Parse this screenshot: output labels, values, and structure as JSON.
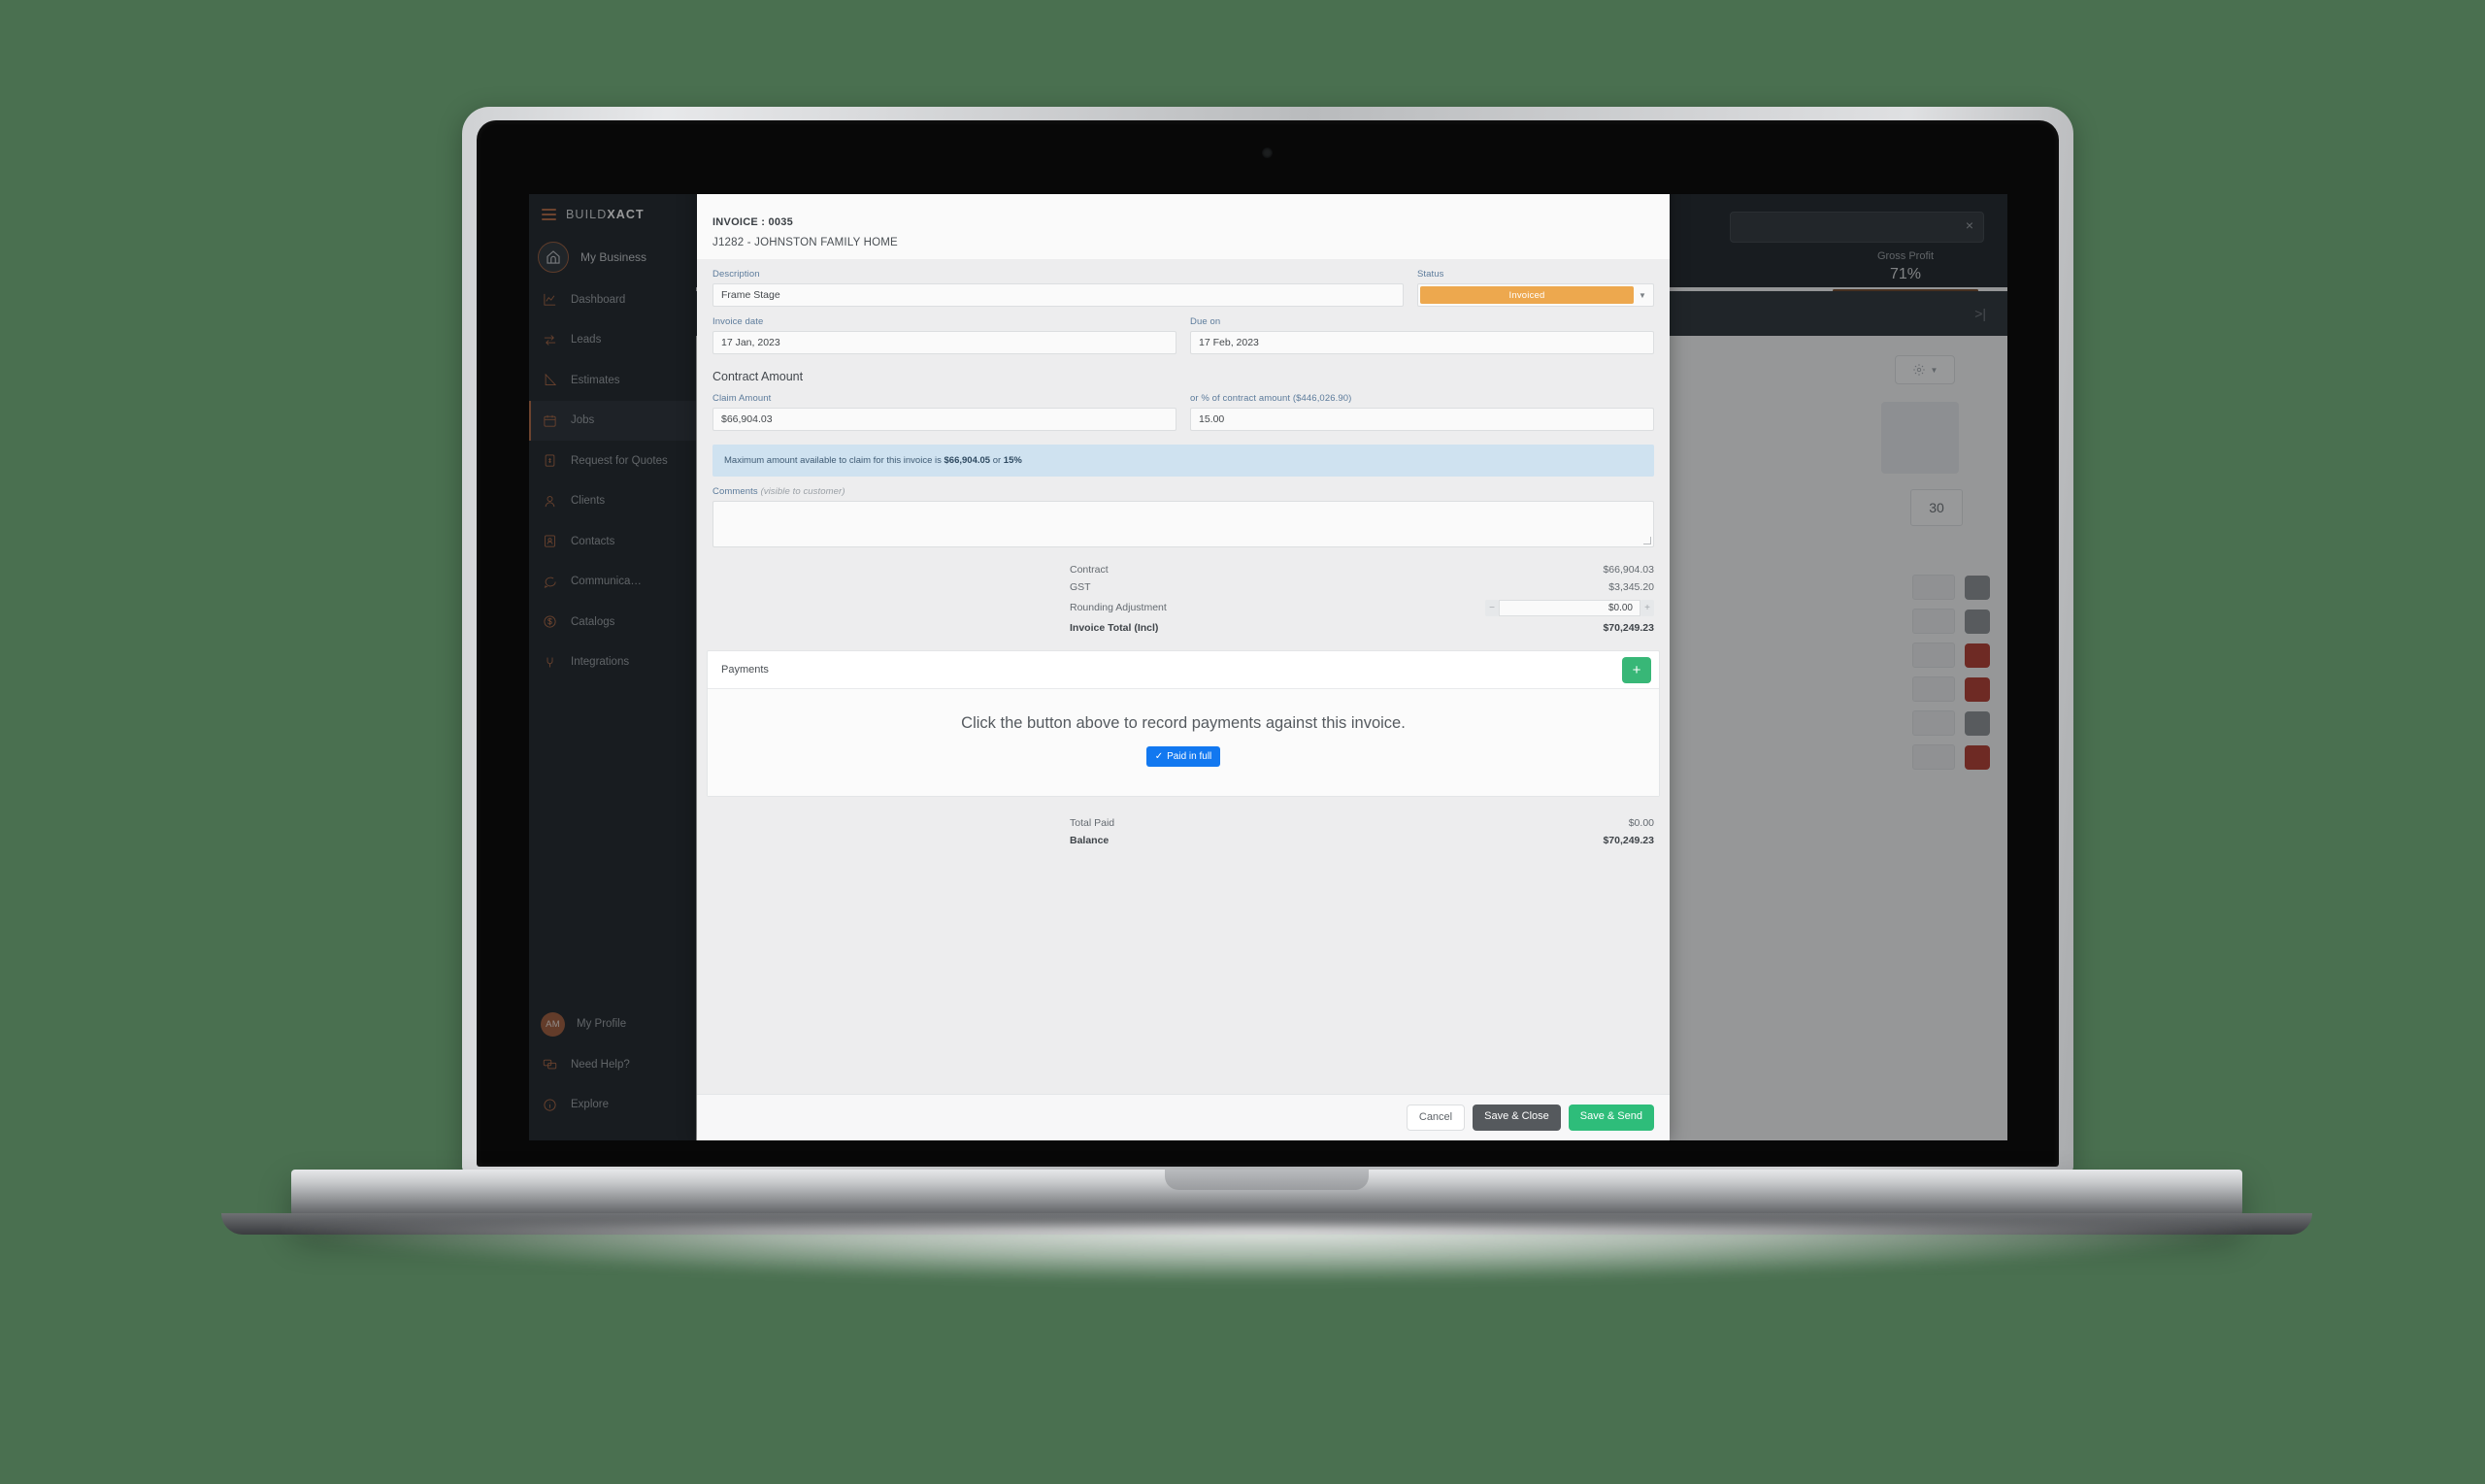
{
  "sidebar": {
    "brand": {
      "light": "BUILD",
      "bold": "XACT"
    },
    "business": "My Business",
    "items": [
      {
        "label": "Dashboard",
        "icon": "chart-icon"
      },
      {
        "label": "Leads",
        "icon": "arrows-icon"
      },
      {
        "label": "Estimates",
        "icon": "ruler-icon"
      },
      {
        "label": "Jobs",
        "icon": "calendar-icon"
      },
      {
        "label": "Request for Quotes",
        "icon": "document-icon"
      },
      {
        "label": "Clients",
        "icon": "person-icon"
      },
      {
        "label": "Contacts",
        "icon": "contact-card-icon"
      },
      {
        "label": "Communica…",
        "icon": "chat-icon"
      },
      {
        "label": "Catalogs",
        "icon": "dollar-circle-icon"
      },
      {
        "label": "Integrations",
        "icon": "plug-icon"
      }
    ],
    "bottom": [
      {
        "label": "My Profile",
        "initials": "AM"
      },
      {
        "label": "Need Help?",
        "icon": "chat-bubbles-icon"
      },
      {
        "label": "Explore",
        "icon": "info-icon"
      }
    ]
  },
  "background": {
    "gross_profit_label": "Gross Profit",
    "gross_profit_value": "71%",
    "collapse_icon": ">|",
    "quantity": "30",
    "close_icon": "×"
  },
  "modal": {
    "title": "INVOICE : 0035",
    "subtitle": "J1282 - JOHNSTON FAMILY HOME",
    "description": {
      "label": "Description",
      "value": "Frame Stage"
    },
    "status": {
      "label": "Status",
      "value": "Invoiced",
      "color": "#eda84e"
    },
    "invoice_date": {
      "label": "Invoice date",
      "value": "17 Jan, 2023"
    },
    "due_on": {
      "label": "Due on",
      "value": "17 Feb, 2023"
    },
    "contract_amount_heading": "Contract Amount",
    "claim_amount": {
      "label": "Claim Amount",
      "value": "$66,904.03"
    },
    "percent": {
      "label": "or % of contract amount ($446,026.90)",
      "value": "15.00"
    },
    "banner": {
      "pre": "Maximum amount available to claim for this invoice is ",
      "amount": "$66,904.05",
      "mid": " or ",
      "percent": "15%"
    },
    "comments": {
      "label": "Comments",
      "note": "(visible to customer)",
      "value": ""
    },
    "totals": [
      {
        "key": "Contract",
        "value": "$66,904.03",
        "bold": false
      },
      {
        "key": "GST",
        "value": "$3,345.20",
        "bold": false
      }
    ],
    "rounding": {
      "label": "Rounding Adjustment",
      "value": "$0.00",
      "minus": "−",
      "plus": "+"
    },
    "invoice_total": {
      "key": "Invoice Total (Incl)",
      "value": "$70,249.23"
    },
    "payments": {
      "title": "Payments",
      "add_icon": "+",
      "empty_message": "Click the button above to record payments against this invoice.",
      "paid_in_full": "Paid in full",
      "paid_check": "✓"
    },
    "totals2": [
      {
        "key": "Total Paid",
        "value": "$0.00",
        "bold": false
      },
      {
        "key": "Balance",
        "value": "$70,249.23",
        "bold": true
      }
    ],
    "footer": {
      "cancel": "Cancel",
      "save_close": "Save & Close",
      "save_send": "Save & Send"
    }
  }
}
